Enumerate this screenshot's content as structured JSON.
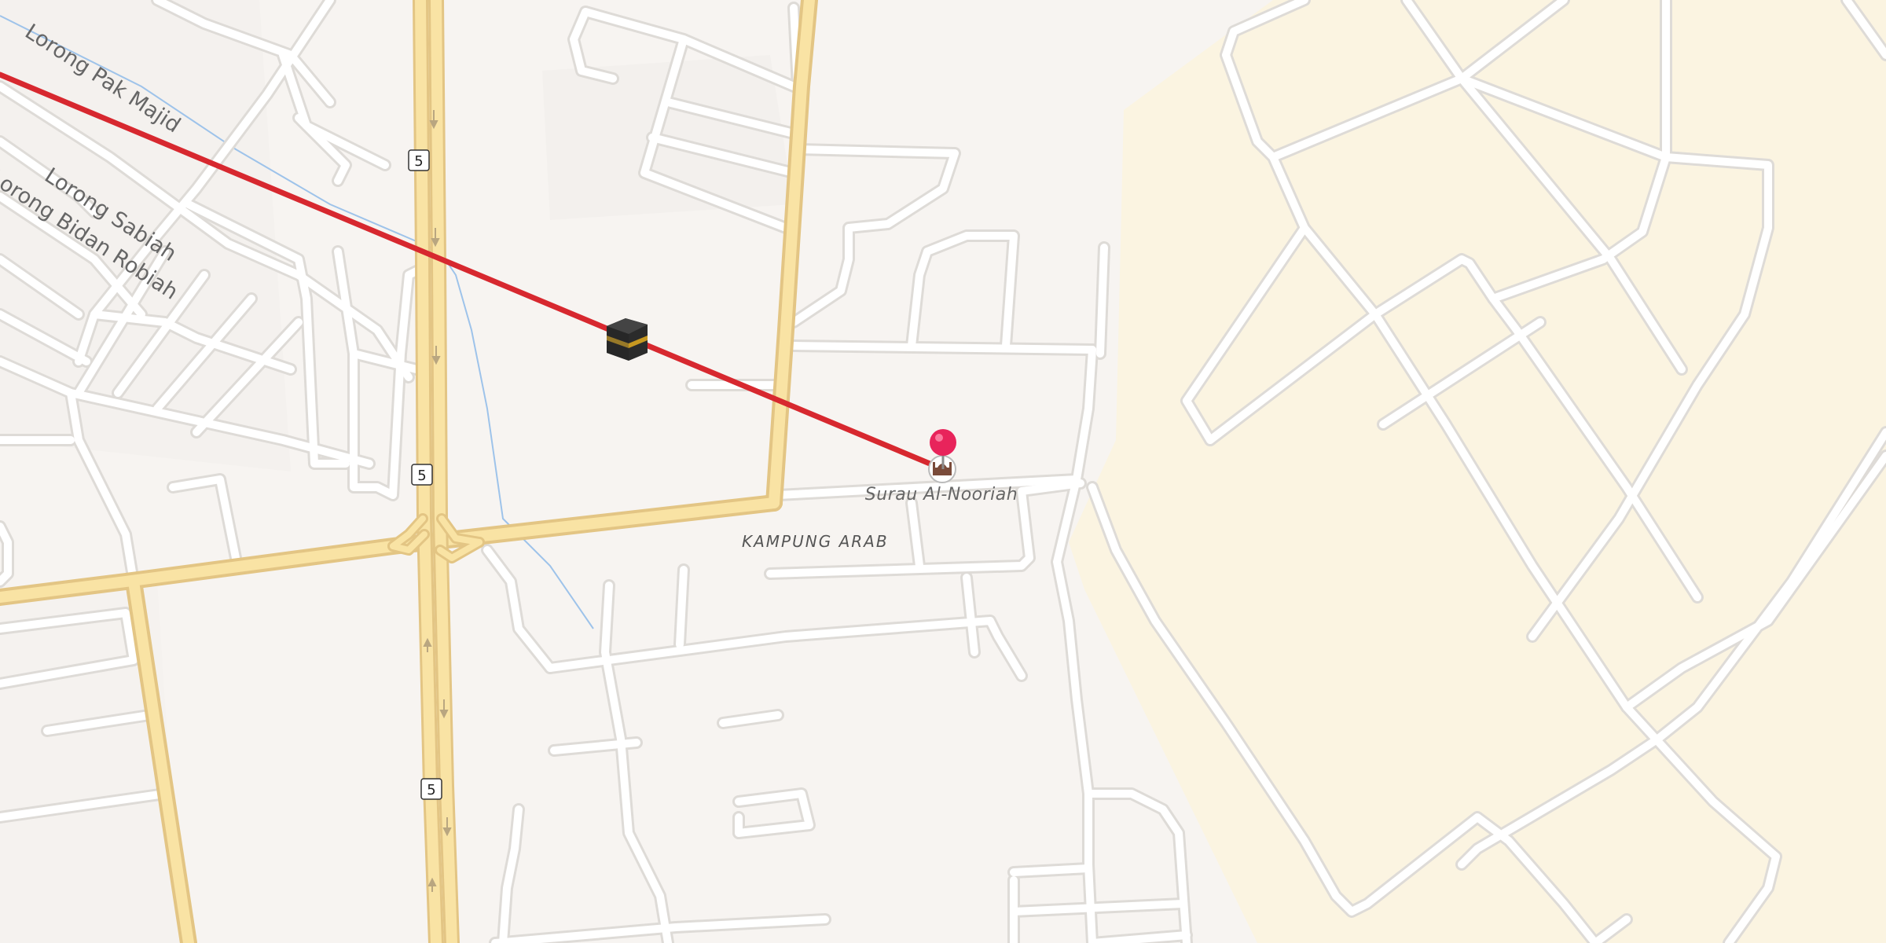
{
  "map": {
    "streets": {
      "lorong_pak_majid": "Lorong Pak Majid",
      "lorong_sabiah": "Lorong Sabiah",
      "lorong_bidan_robiah": "Lorong Bidan Robiah"
    },
    "area_label": "KAMPUNG ARAB",
    "poi": {
      "name": "Surau Al-Nooriah",
      "icon": "mosque-icon",
      "marker": "map-pin-icon"
    },
    "route_marker_icon": "kaaba-icon",
    "route_shields": [
      "5",
      "5",
      "5"
    ],
    "colors": {
      "background": "#f7f4f1",
      "plantation": "#fbf4e1",
      "road": "#ffffff",
      "road_casing": "#dedbd7",
      "highway": "#f9e3a4",
      "highway_casing": "#e3c584",
      "qibla_line": "#d7282f",
      "pin": "#e8245b",
      "water": "#9ec3ea"
    }
  }
}
